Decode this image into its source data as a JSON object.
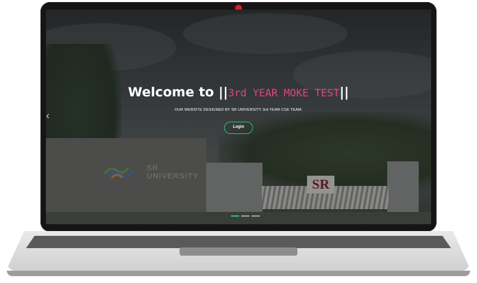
{
  "hero": {
    "title_prefix": "Welcome to",
    "bar_left": "||",
    "typed_text": "3rd YEAR MOKE TEST",
    "bar_right": "||",
    "subtitle": "OUR WEBSITE DESIGNED BY SR UNIVERSITY 3rd YEAR CSE TEAM.",
    "login_label": "Login"
  },
  "scene": {
    "building_sign": "SR\nUNIVERSITY",
    "gate_sign": "SR"
  },
  "carousel": {
    "prev_icon": "‹",
    "indicators": [
      {
        "state": "active"
      },
      {
        "state": "inactive"
      },
      {
        "state": "inactive"
      }
    ]
  },
  "colors": {
    "typed_text": "#e0457b",
    "accent_green": "#2db87c",
    "camera_red": "#c4262e"
  }
}
